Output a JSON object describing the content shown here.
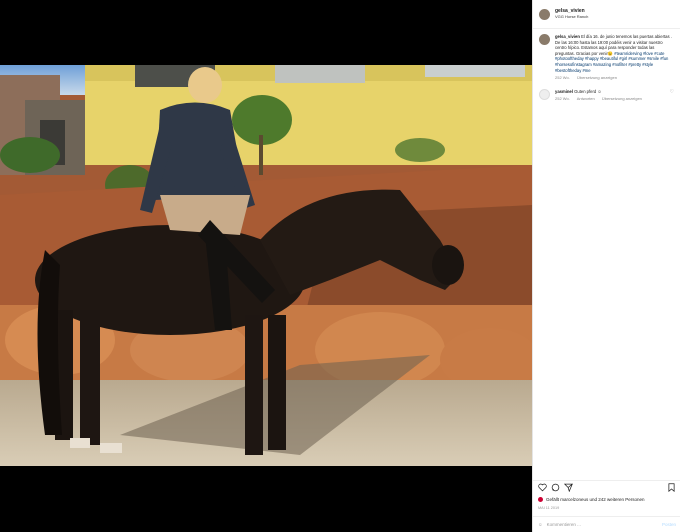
{
  "post": {
    "username": "gelsa_vivien",
    "location": "VGG Horse Ranch"
  },
  "comments": [
    {
      "username": "gelsa_vivien",
      "text": "El día 16. de junio tenemos las puertas abiertas . De las 16:00 hasta las 19:00 podéis venir a visitar nuestro centro hípico. Estamos aquí para responder todas las preguntas. Gracias por venir😉",
      "tags": "#teamriderving #love #cute #photooftheday #happy #beautiful #girl #summer #smile #fun #horsesofinstagram #amazing #nofilter #pretty #style #bestoftheday #me",
      "time": "252 Wo.",
      "translate": "Übersetzung anzeigen"
    },
    {
      "username": "yasminel",
      "text": "Guten pferd ☺",
      "time": "252 Wo.",
      "reply": "Antworten",
      "translate": "Übersetzung anzeigen"
    }
  ],
  "likes_text": "Gefällt marcelzoneus und 242 weiteren Personen",
  "date": "MAI 11 2019",
  "add_comment_placeholder": "Kommentieren ...",
  "post_label": "Posten",
  "colors": {
    "link": "#00376b",
    "like": "#cc0033"
  }
}
